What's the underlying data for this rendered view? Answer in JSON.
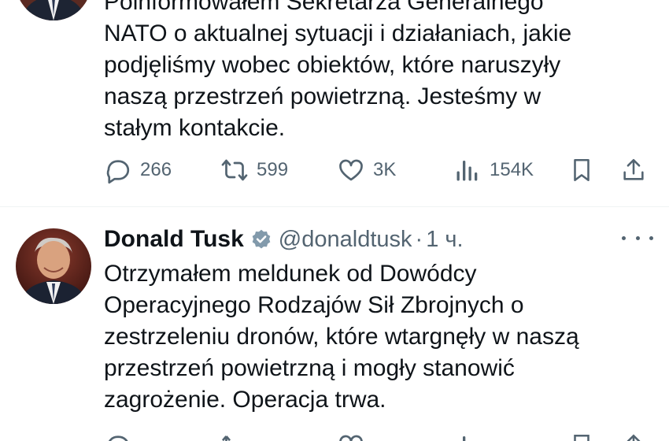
{
  "tweet_1": {
    "text_lines": [
      "Poinformowałem Sekretarza Generalnego",
      "NATO o aktualnej sytuacji i działaniach, jakie",
      "podjęliśmy wobec obiektów, które naruszyły",
      "naszą przestrzeń powietrzną. Jesteśmy w",
      "stałym kontakcie."
    ],
    "replies": "266",
    "reposts": "599",
    "likes": "3K",
    "views": "154K"
  },
  "tweet_2": {
    "display_name": "Donald Tusk",
    "handle": "@donaldtusk",
    "separator": "·",
    "time": "1 ч.",
    "text_lines": [
      "Otrzymałem meldunek od Dowódcy",
      "Operacyjnego Rodzajów Sił Zbrojnych o",
      "zestrzeleniu dronów, które wtargnęły w naszą",
      "przestrzeń powietrzną i mogły stanowić",
      "zagrożenie. Operacja trwa."
    ]
  },
  "icons": {
    "reply": "reply-icon",
    "repost": "repost-icon",
    "like": "like-icon",
    "views": "views-icon",
    "bookmark": "bookmark-icon",
    "share": "share-icon",
    "verified": "verified-badge-icon",
    "more": "more-options-icon"
  },
  "colors": {
    "text": "#0f1419",
    "secondary": "#536471",
    "divider": "#eff3f4",
    "verified_badge": "#829aab"
  }
}
